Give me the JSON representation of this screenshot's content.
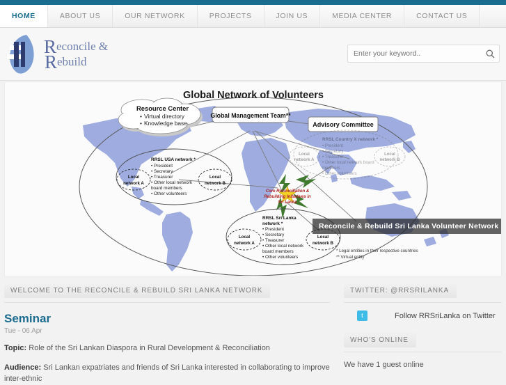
{
  "brand": {
    "name_line1": "Reconcile &",
    "name_line2": "Rebuild",
    "cap1": "R",
    "cap2": "R",
    "rest1": "econcile &",
    "rest2": "ebuild",
    "accent_color": "#1a6d8e",
    "logo_color": "#6f7fae"
  },
  "nav": {
    "items": [
      {
        "label": "HOME",
        "active": true
      },
      {
        "label": "ABOUT US",
        "active": false
      },
      {
        "label": "OUR NETWORK",
        "active": false
      },
      {
        "label": "PROJECTS",
        "active": false
      },
      {
        "label": "JOIN US",
        "active": false
      },
      {
        "label": "MEDIA CENTER",
        "active": false
      },
      {
        "label": "CONTACT US",
        "active": false
      }
    ]
  },
  "search": {
    "placeholder": "Enter your keyword..",
    "value": "",
    "icon": "search-icon"
  },
  "banner": {
    "caption": "Reconcile & Rebuild Sri Lanka Volunteer Network Structure",
    "diagram": {
      "title": "Global Network of Volunteers",
      "nodes": {
        "resource_center": {
          "title": "Resource Center",
          "bullets": [
            "Virtual directory",
            "Knowledge base"
          ]
        },
        "global_management_team": {
          "title": "Global Management Team**"
        },
        "advisory_committee": {
          "title": "Advisory Committee"
        },
        "core_initiative": {
          "line1": "Core Reconciliation &",
          "line2": "Rebuilding Initiatives in",
          "line3": "Sri Lanka"
        },
        "usa_network": {
          "title_line1": "RRSL  USA network *",
          "bullets": [
            "President",
            "Secretary",
            "Treasurer",
            "Other local network",
            "board members",
            "Other volunteers"
          ],
          "local_a": "Local network A",
          "local_b": "Local network B"
        },
        "country_x_network": {
          "title_line1": "RRSL  Country X network *",
          "bullets": [
            "President",
            "Secretary",
            "Treasurer",
            "Other local network board",
            "members",
            "Other volunteers"
          ],
          "local_a": "Local network A",
          "local_b": "Local network B"
        },
        "sri_lanka_network": {
          "title_line1": "RRSL  Sri Lanka",
          "title_line2": "network *",
          "bullets": [
            "President",
            "Secretary",
            "Treasurer",
            "Other local network",
            "board members",
            "Other volunteers"
          ],
          "local_a": "Local network A",
          "local_b": "Local network B"
        }
      },
      "footnotes": [
        "* Legal entities in their respective countries",
        "** Virtual entity"
      ],
      "colors": {
        "map": "#9aa8de",
        "arrow": "#3f7a2e",
        "star": "#f4d02a",
        "red_text": "#b02020"
      }
    }
  },
  "main": {
    "section_title": "WELCOME TO THE RECONCILE & REBUILD SRI LANKA NETWORK",
    "post": {
      "title": "Seminar",
      "date": "Tue - 06 Apr",
      "topic_label": "Topic:",
      "topic_text": " Role of the Sri Lankan Diaspora in Rural Development & Reconciliation",
      "audience_label": "Audience:",
      "audience_text": " Sri Lankan expatriates and friends of Sri Lanka interested in collaborating to improve inter-ethnic"
    }
  },
  "sidebar": {
    "twitter": {
      "title": "TWITTER: @RRSRILANKA",
      "link_label": "Follow RRSriLanka on Twitter",
      "icon": "twitter-bird-icon",
      "icon_glyph": "t",
      "icon_color": "#3fbbe8"
    },
    "who_online": {
      "title": "WHO'S ONLINE",
      "text": "We have 1 guest online"
    }
  }
}
